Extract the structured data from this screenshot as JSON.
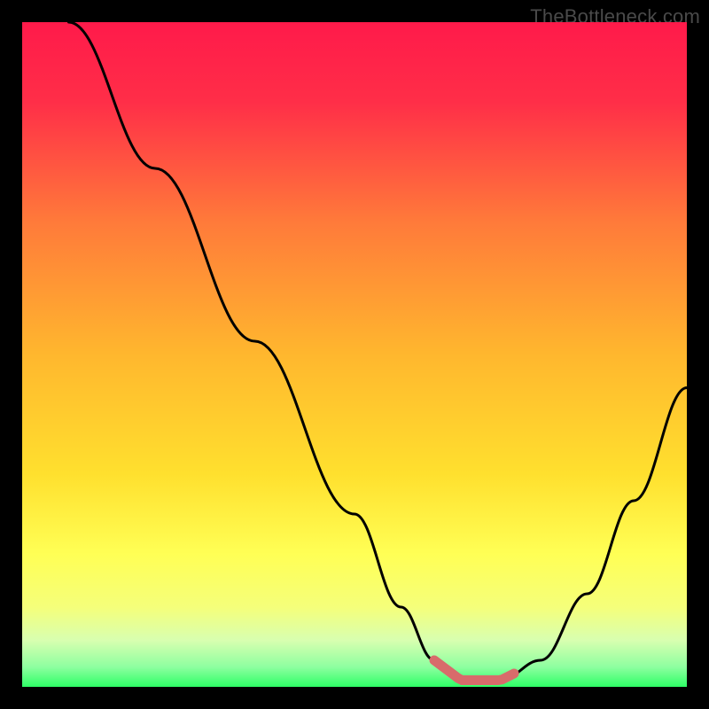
{
  "watermark": "TheBottleneck.com",
  "chart_data": {
    "type": "line",
    "title": "",
    "xlabel": "",
    "ylabel": "",
    "xlim": [
      0,
      100
    ],
    "ylim": [
      0,
      100
    ],
    "grid": false,
    "legend": false,
    "background_gradient": [
      "#ff1a4a",
      "#ffd22e",
      "#ffff66",
      "#2eff66"
    ],
    "series": [
      {
        "name": "bottleneck-curve",
        "color": "#000000",
        "x": [
          7,
          20,
          35,
          50,
          57,
          62,
          66,
          72,
          78,
          85,
          92,
          100
        ],
        "y": [
          100,
          78,
          52,
          26,
          12,
          4,
          1,
          1,
          4,
          14,
          28,
          45
        ]
      }
    ],
    "annotations": [
      {
        "name": "optimal-band",
        "type": "highlight",
        "x_start": 62,
        "x_end": 74,
        "color": "#d86b6b"
      }
    ]
  },
  "colors": {
    "frame": "#000000",
    "curve": "#000000",
    "highlight": "#d86b6b"
  }
}
